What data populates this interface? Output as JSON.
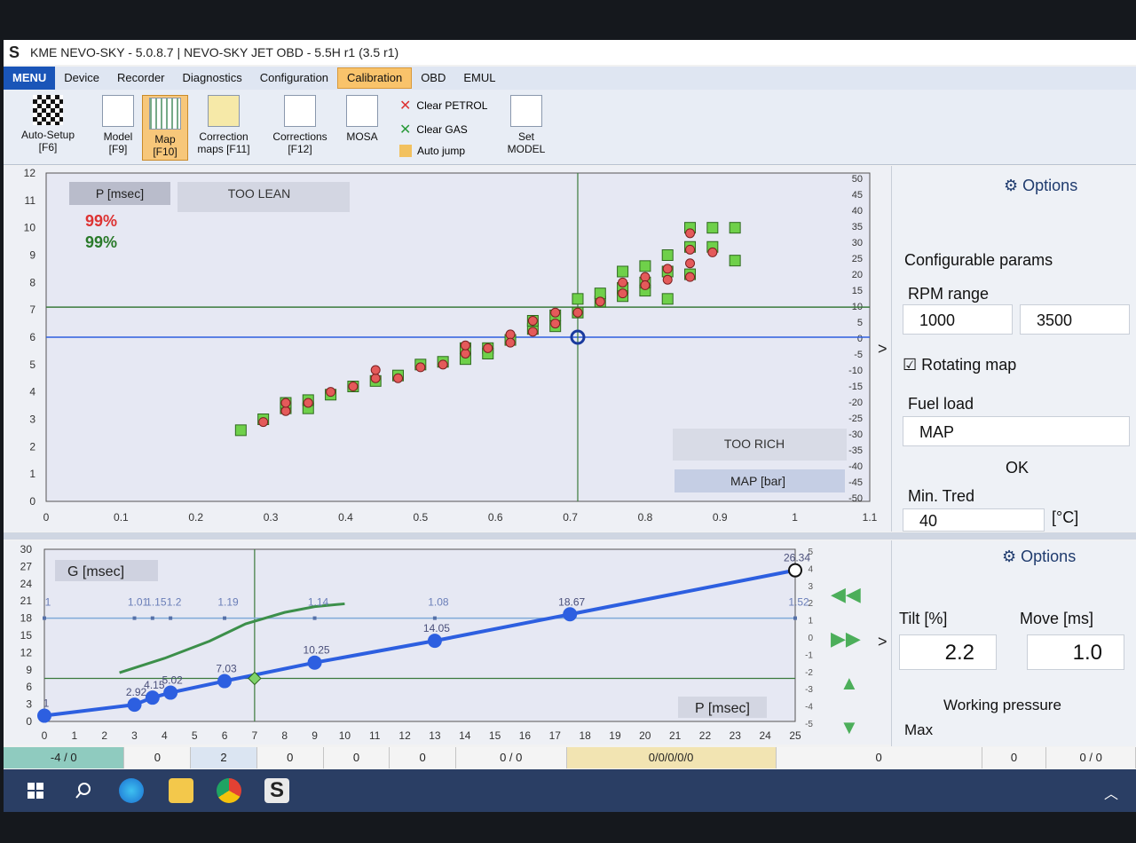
{
  "window": {
    "title": "KME NEVO-SKY - 5.0.8.7  |  NEVO-SKY JET OBD - 5.5H r1 (3.5 r1)",
    "logo": "S"
  },
  "menubar": {
    "items": [
      "MENU",
      "Device",
      "Recorder",
      "Diagnostics",
      "Configuration",
      "Calibration",
      "OBD",
      "EMUL"
    ],
    "active": "Calibration"
  },
  "ribbon": {
    "autosetup": "Auto-Setup",
    "autosetup_key": "[F6]",
    "model": "Model",
    "model_key": "[F9]",
    "map": "Map",
    "map_key": "[F10]",
    "corr_maps": "Correction",
    "corr_maps2": "maps [F11]",
    "corrections": "Corrections",
    "corrections_key": "[F12]",
    "mosa": "MOSA",
    "clear_petrol": "Clear PETROL",
    "clear_gas": "Clear GAS",
    "auto_jump": "Auto jump",
    "set_model": "Set",
    "set_model2": "MODEL"
  },
  "upper_chart": {
    "p_label": "P [msec]",
    "too_lean": "TOO LEAN",
    "pct_red": "99%",
    "pct_green": "99%",
    "too_rich": "TOO RICH",
    "map_label": "MAP [bar]",
    "arrow": ">"
  },
  "right_panel": {
    "options": "Options",
    "configurable": "Configurable params",
    "rpm_range": "RPM range",
    "rpm_min": "1000",
    "rpm_max": "3500",
    "rotating_map": "Rotating map",
    "fuel_load": "Fuel load",
    "fuel_load_value": "MAP",
    "ok": "OK",
    "min_tred": "Min. Tred",
    "min_tred_value": "40",
    "min_tred_unit": "[°C]"
  },
  "lower_chart": {
    "g_label": "G [msec]",
    "p_label": "P [msec]",
    "arrow": ">",
    "end_label": "26.34"
  },
  "right_panel2": {
    "options": "Options",
    "tilt_label": "Tilt [%]",
    "move_label": "Move [ms]",
    "tilt_value": "2.2",
    "move_value": "1.0",
    "working_pressure": "Working pressure",
    "max": "Max"
  },
  "statusbar": [
    "-4 / 0",
    "0",
    "2",
    "0",
    "0",
    "0",
    "0 / 0",
    "0/0/0/0/0",
    "0",
    "0",
    "0 / 0"
  ],
  "colors": {
    "accent": "#1a55b8",
    "active_tab": "#f9c36b",
    "green_cell": "#6fd04a",
    "red_point": "#e45a5a",
    "blue_line": "#2d5fe0"
  },
  "chart_data": [
    {
      "type": "scatter",
      "xlim": [
        0,
        1.1
      ],
      "ylim": [
        0,
        12
      ],
      "y2lim": [
        -50,
        50
      ],
      "x_ticks": [
        "0",
        "0.1",
        "0.2",
        "0.3",
        "0.4",
        "0.5",
        "0.6",
        "0.7",
        "0.8",
        "0.9",
        "1",
        "1.1"
      ],
      "y_ticks": [
        "0",
        "1",
        "2",
        "3",
        "4",
        "5",
        "6",
        "7",
        "8",
        "9",
        "10",
        "11",
        "12"
      ],
      "y2_ticks": [
        "50",
        "45",
        "40",
        "35",
        "30",
        "25",
        "20",
        "15",
        "10",
        "5",
        "0",
        "-5",
        "-10",
        "-15",
        "-20",
        "-25",
        "-30",
        "-35",
        "-40",
        "-45",
        "-50"
      ],
      "series": [
        {
          "points": [
            [
              0.26,
              2.6
            ],
            [
              0.29,
              3.0
            ],
            [
              0.32,
              3.4
            ],
            [
              0.32,
              3.6
            ],
            [
              0.35,
              3.4
            ],
            [
              0.35,
              3.7
            ],
            [
              0.38,
              3.9
            ],
            [
              0.41,
              4.2
            ],
            [
              0.44,
              4.4
            ],
            [
              0.47,
              4.6
            ],
            [
              0.5,
              5.0
            ],
            [
              0.53,
              5.1
            ],
            [
              0.56,
              5.6
            ],
            [
              0.56,
              5.2
            ],
            [
              0.59,
              5.6
            ],
            [
              0.59,
              5.4
            ],
            [
              0.62,
              5.9
            ],
            [
              0.65,
              6.3
            ],
            [
              0.65,
              6.6
            ],
            [
              0.68,
              6.4
            ],
            [
              0.68,
              6.8
            ],
            [
              0.71,
              6.9
            ],
            [
              0.71,
              7.4
            ],
            [
              0.74,
              7.3
            ],
            [
              0.74,
              7.6
            ],
            [
              0.77,
              7.8
            ],
            [
              0.77,
              8.4
            ],
            [
              0.77,
              7.5
            ],
            [
              0.8,
              7.7
            ],
            [
              0.8,
              8.0
            ],
            [
              0.8,
              8.6
            ],
            [
              0.83,
              7.4
            ],
            [
              0.83,
              8.4
            ],
            [
              0.83,
              9.0
            ],
            [
              0.86,
              8.3
            ],
            [
              0.86,
              9.3
            ],
            [
              0.86,
              10.0
            ],
            [
              0.89,
              10.0
            ],
            [
              0.89,
              9.3
            ],
            [
              0.92,
              10.0
            ],
            [
              0.92,
              8.8
            ]
          ]
        },
        {
          "points": [
            [
              0.29,
              2.9
            ],
            [
              0.32,
              3.3
            ],
            [
              0.32,
              3.6
            ],
            [
              0.35,
              3.6
            ],
            [
              0.38,
              4.0
            ],
            [
              0.41,
              4.2
            ],
            [
              0.44,
              4.5
            ],
            [
              0.44,
              4.8
            ],
            [
              0.47,
              4.5
            ],
            [
              0.5,
              4.9
            ],
            [
              0.53,
              5.0
            ],
            [
              0.56,
              5.4
            ],
            [
              0.56,
              5.7
            ],
            [
              0.59,
              5.6
            ],
            [
              0.62,
              6.1
            ],
            [
              0.62,
              5.8
            ],
            [
              0.65,
              6.2
            ],
            [
              0.65,
              6.6
            ],
            [
              0.68,
              6.5
            ],
            [
              0.68,
              6.9
            ],
            [
              0.71,
              6.9
            ],
            [
              0.74,
              7.3
            ],
            [
              0.77,
              7.6
            ],
            [
              0.77,
              8.0
            ],
            [
              0.8,
              8.2
            ],
            [
              0.8,
              7.9
            ],
            [
              0.83,
              8.1
            ],
            [
              0.83,
              8.5
            ],
            [
              0.86,
              8.2
            ],
            [
              0.86,
              8.7
            ],
            [
              0.86,
              9.2
            ],
            [
              0.86,
              9.8
            ],
            [
              0.89,
              9.1
            ]
          ]
        }
      ],
      "crosshair": {
        "x": 0.71,
        "y": 6.0
      },
      "ref_line_y": 7.1
    },
    {
      "type": "line",
      "xlim": [
        0,
        25
      ],
      "ylim": [
        0,
        30
      ],
      "x_ticks": [
        "0",
        "1",
        "2",
        "3",
        "4",
        "5",
        "6",
        "7",
        "8",
        "9",
        "10",
        "11",
        "12",
        "13",
        "14",
        "15",
        "16",
        "17",
        "18",
        "19",
        "20",
        "21",
        "22",
        "23",
        "24",
        "25"
      ],
      "y_ticks": [
        "0",
        "3",
        "6",
        "9",
        "12",
        "15",
        "18",
        "21",
        "24",
        "27",
        "30"
      ],
      "y2_ticks": [
        "5",
        "4",
        "3",
        "2",
        "1",
        "0",
        "-1",
        "-2",
        "-3",
        "-4",
        "-5"
      ],
      "series": [
        {
          "name": "",
          "points": [
            [
              0,
              1
            ],
            [
              3,
              2.92
            ],
            [
              3.6,
              4.15
            ],
            [
              4.2,
              5.02
            ],
            [
              6,
              7.03
            ],
            [
              9,
              10.25
            ],
            [
              13,
              14.05
            ],
            [
              17.5,
              18.67
            ],
            [
              25,
              26.34
            ]
          ]
        },
        {
          "name": "",
          "points": [
            [
              0,
              18
            ],
            [
              3,
              18
            ],
            [
              3.6,
              18
            ],
            [
              4.2,
              18
            ],
            [
              6,
              18
            ],
            [
              9,
              18
            ],
            [
              13,
              18
            ],
            [
              25,
              18
            ]
          ]
        },
        {
          "name": "",
          "points": [
            [
              2.5,
              8.5
            ],
            [
              4,
              11
            ],
            [
              5.5,
              14
            ],
            [
              6.7,
              17
            ],
            [
              8,
              19
            ],
            [
              9,
              20
            ],
            [
              10,
              20.5
            ]
          ]
        }
      ],
      "labels_blue": [
        "1",
        "2.92",
        "4.15",
        "5.02",
        "7.03",
        "10.25",
        "14.05",
        "18.67",
        "26.34"
      ],
      "labels_corr": [
        "1",
        "1.01",
        "1.15",
        "1.2",
        "1.19",
        "1.14",
        "1.08",
        "1.52"
      ],
      "ref_line_y": 7.5,
      "crosshair_x": 7
    }
  ]
}
